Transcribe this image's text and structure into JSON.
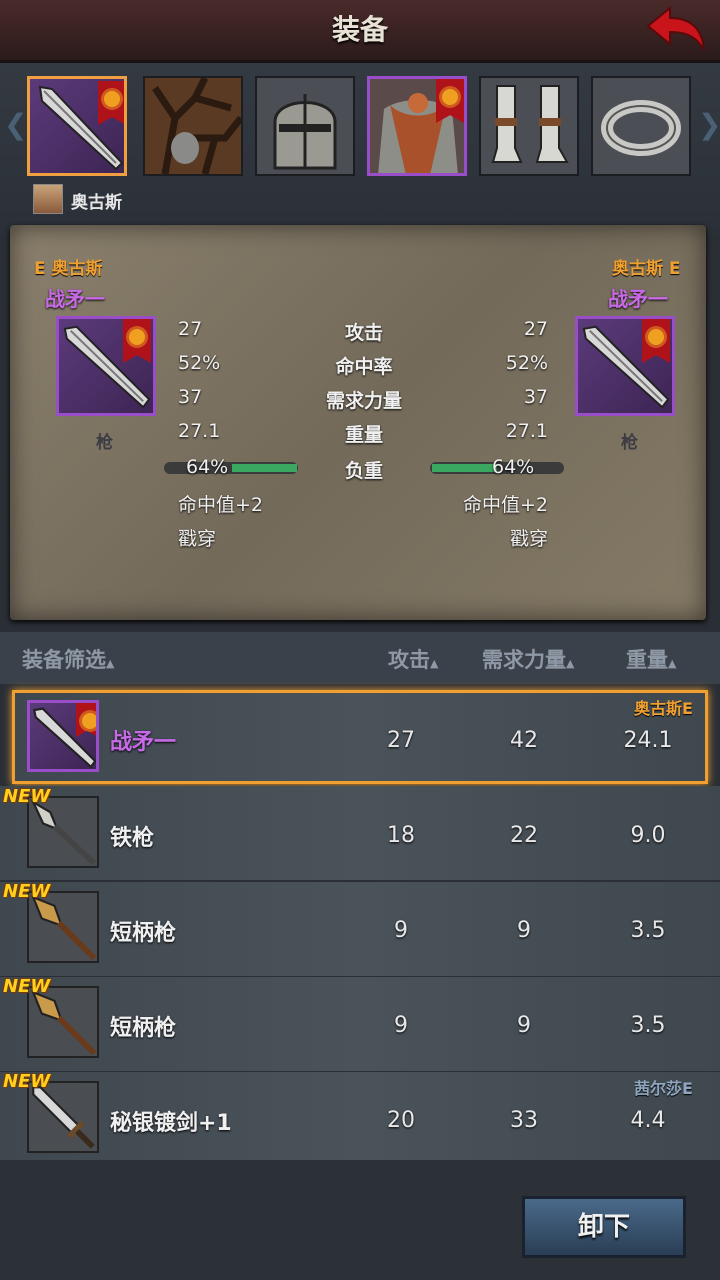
{
  "header": {
    "title": "装备"
  },
  "character": {
    "name": "奥古斯"
  },
  "compare": {
    "left": {
      "owner": "E 奥古斯",
      "item_name": "战矛一",
      "type": "枪"
    },
    "right": {
      "owner": "奥古斯 E",
      "item_name": "战矛一",
      "type": "枪"
    },
    "stats": [
      {
        "left": "27",
        "label": "攻击",
        "right": "27"
      },
      {
        "left": "52%",
        "label": "命中率",
        "right": "52%"
      },
      {
        "left": "37",
        "label": "需求力量",
        "right": "37"
      },
      {
        "left": "27.1",
        "label": "重量",
        "right": "27.1"
      }
    ],
    "load": {
      "label": "负重",
      "left": "64%",
      "right": "64%",
      "fraction": 0.64
    },
    "traits": [
      {
        "left": "命中值+2",
        "right": "命中值+2"
      },
      {
        "left": "戳穿",
        "right": "戳穿"
      }
    ]
  },
  "list": {
    "headers": {
      "filter": "装备筛选",
      "attack": "攻击",
      "strength": "需求力量",
      "weight": "重量"
    },
    "rows": [
      {
        "name": "战矛一",
        "attack": "27",
        "strength": "42",
        "weight": "24.1",
        "owner": "奥古斯E",
        "new": "",
        "selected": true
      },
      {
        "name": "铁枪",
        "attack": "18",
        "strength": "22",
        "weight": "9.0",
        "owner": "",
        "new": "NEW"
      },
      {
        "name": "短柄枪",
        "attack": "9",
        "strength": "9",
        "weight": "3.5",
        "owner": "",
        "new": "NEW"
      },
      {
        "name": "短柄枪",
        "attack": "9",
        "strength": "9",
        "weight": "3.5",
        "owner": "",
        "new": "NEW"
      },
      {
        "name": "秘银镀剑+1",
        "attack": "20",
        "strength": "33",
        "weight": "4.4",
        "owner": "茜尔莎E",
        "new": "NEW"
      }
    ]
  },
  "footer": {
    "unequip_label": "卸下"
  },
  "colors": {
    "accent_orange": "#f0a030",
    "rarity_purple": "#c86ae8",
    "load_green": "#3aa860",
    "owner_self": "#f0a030",
    "owner_other": "#8fa6c0"
  },
  "icons": {
    "slots": [
      "spear-icon",
      "tree-bark-armor-icon",
      "helmet-icon",
      "fur-armor-icon",
      "greaves-icon",
      "ring-icon"
    ]
  }
}
